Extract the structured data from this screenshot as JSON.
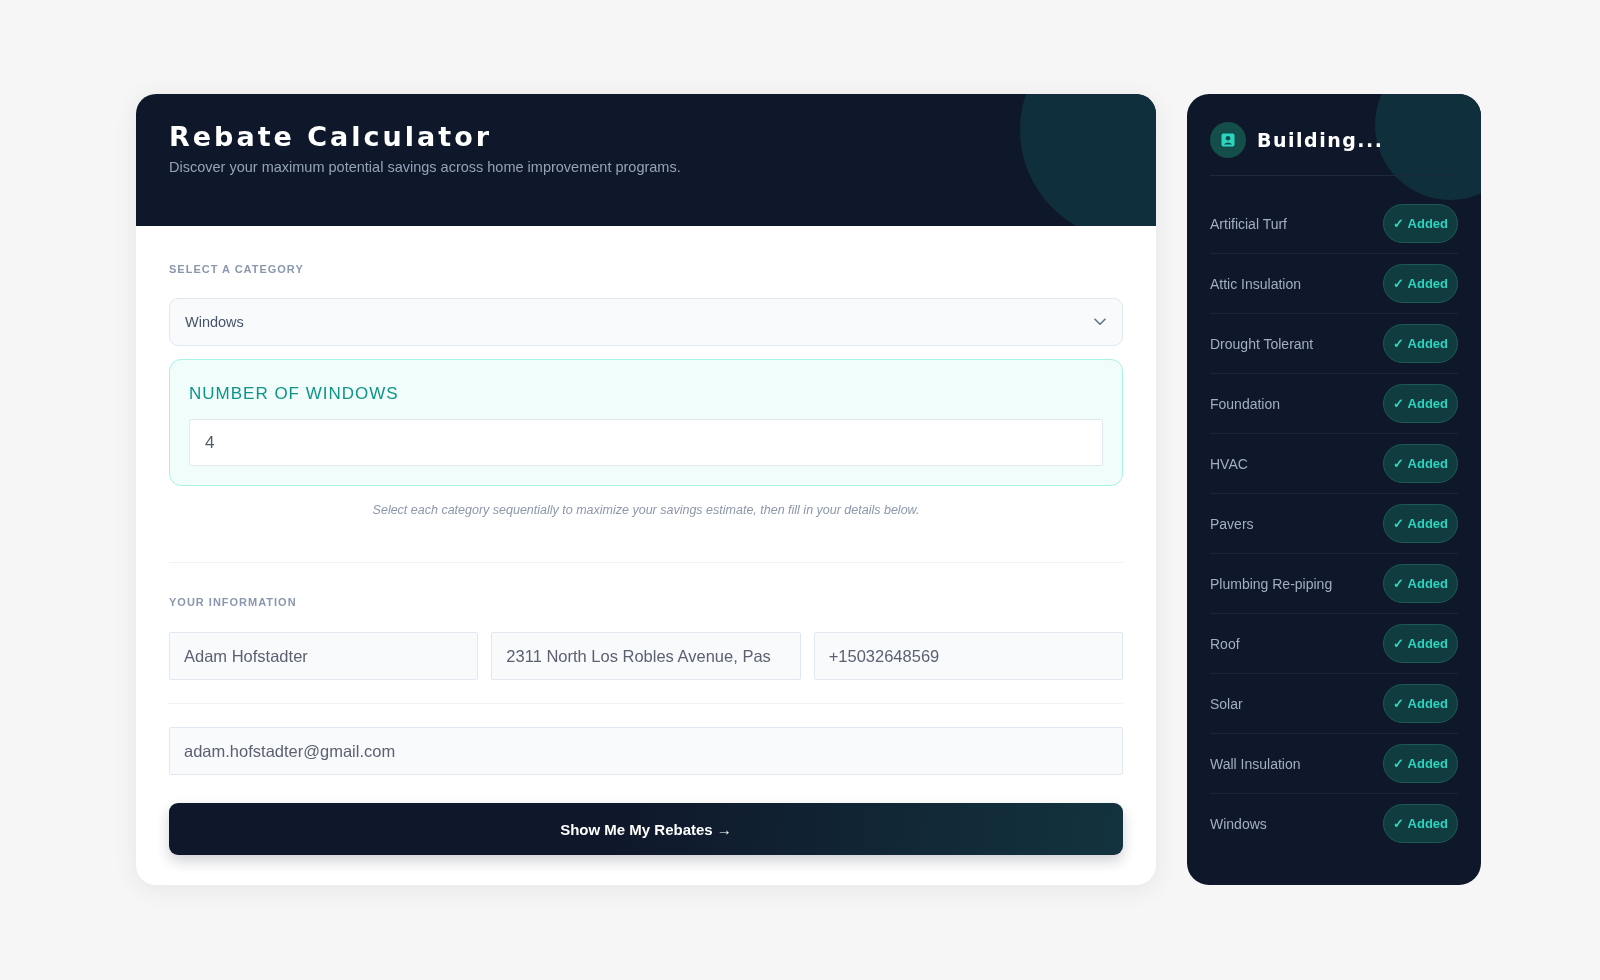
{
  "calculator": {
    "title": "Rebate Calculator",
    "subtitle": "Discover your maximum potential savings across home improvement programs.",
    "category_section": {
      "label": "SELECT A CATEGORY",
      "select": {
        "value": "Windows"
      },
      "quantity": {
        "label": "NUMBER OF WINDOWS",
        "value": "4"
      },
      "hint": "Select each category sequentially to maximize your savings estimate, then fill in your details below."
    },
    "info_section": {
      "label": "YOUR INFORMATION",
      "field_rows": [
        {
          "fields": [
            {
              "value": "Adam Hofstadter"
            },
            {
              "value": "2311 North Los Robles Avenue, Pas"
            },
            {
              "value": "+15032648569"
            }
          ]
        },
        {
          "fields": [
            {
              "value": "adam.hofstadter@gmail.com"
            }
          ]
        }
      ]
    },
    "submit_button": "Show Me My Rebates →"
  },
  "progress_panel": {
    "title": "Building...",
    "items": [
      {
        "label": "Artificial Turf",
        "badge": "✓ Added"
      },
      {
        "label": "Attic Insulation",
        "badge": "✓ Added"
      },
      {
        "label": "Drought Tolerant",
        "badge": "✓ Added"
      },
      {
        "label": "Foundation",
        "badge": "✓ Added"
      },
      {
        "label": "HVAC",
        "badge": "✓ Added"
      },
      {
        "label": "Pavers",
        "badge": "✓ Added"
      },
      {
        "label": "Plumbing Re-piping",
        "badge": "✓ Added"
      },
      {
        "label": "Roof",
        "badge": "✓ Added"
      },
      {
        "label": "Solar",
        "badge": "✓ Added"
      },
      {
        "label": "Wall Insulation",
        "badge": "✓ Added"
      },
      {
        "label": "Windows",
        "badge": "✓ Added"
      }
    ]
  }
}
